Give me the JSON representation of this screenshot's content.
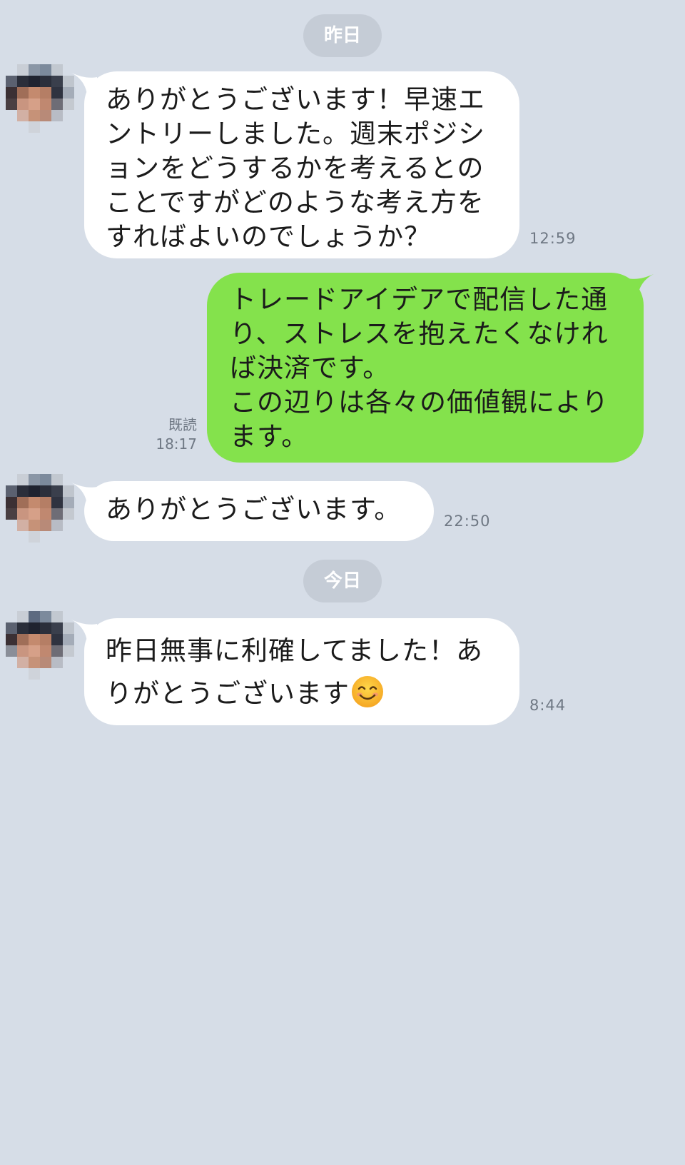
{
  "dates": {
    "yesterday": "昨日",
    "today": "今日"
  },
  "messages": [
    {
      "side": "in",
      "text": "ありがとうございます！早速エ\nントリーしました。週末ポジシ\nョンをどうするかを考えるとの\nことですがどのような考え方を\nすればよいのでしょうか？",
      "time": "12:59"
    },
    {
      "side": "out",
      "text": "トレードアイデアで配信した通\nり、ストレスを抱えたくなけれ\nば決済です。\nこの辺りは各々の価値観により\nます。",
      "read": "既読",
      "time": "18:17"
    },
    {
      "side": "in",
      "text": "ありがとうございます。",
      "time": "22:50"
    },
    {
      "side": "in",
      "text": "昨日無事に利確してました！あ\nりがとうございます",
      "emoji": "smiling-face-emoji",
      "time": "8:44"
    }
  ],
  "colors": {
    "background": "#d6dde7",
    "incoming_bubble": "#ffffff",
    "outgoing_bubble": "#84e24c",
    "date_pill": "#c5ccd6",
    "timestamp": "#6f7884"
  }
}
